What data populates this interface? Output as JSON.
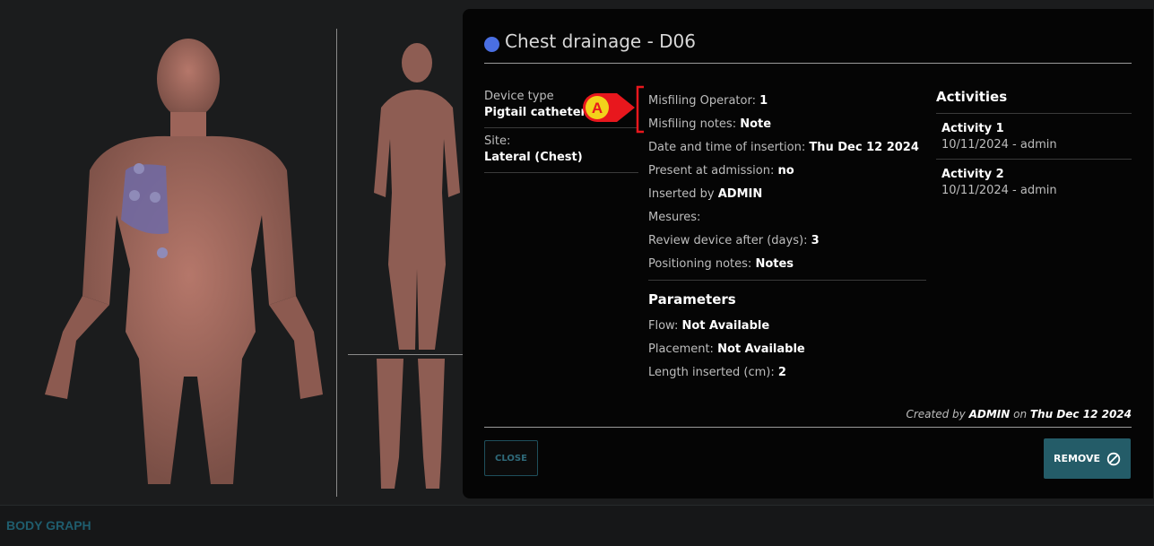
{
  "footer": {
    "label": "BODY GRAPH"
  },
  "modal": {
    "title": "Chest drainage - D06",
    "status_color": "#4a6fe3",
    "left_fields": [
      {
        "label": "Device type",
        "value": "Pigtail catheter"
      },
      {
        "label": "Site:",
        "value": "Lateral (Chest)"
      }
    ],
    "details": [
      {
        "label": "Misfiling Operator: ",
        "value": "1"
      },
      {
        "label": "Misfiling notes: ",
        "value": "Note"
      },
      {
        "label": "Date and time of insertion: ",
        "value": "Thu Dec 12 2024"
      },
      {
        "label": "Present at admission: ",
        "value": "no"
      },
      {
        "label": "Inserted by ",
        "value": "ADMIN"
      },
      {
        "label": "Mesures:",
        "value": ""
      },
      {
        "label": "Review device after (days): ",
        "value": "3"
      },
      {
        "label": "Positioning notes: ",
        "value": "Notes"
      }
    ],
    "parameters_heading": "Parameters",
    "parameters": [
      {
        "label": "Flow: ",
        "value": "Not Available"
      },
      {
        "label": "Placement: ",
        "value": "Not Available"
      },
      {
        "label": "Length inserted (cm): ",
        "value": "2"
      }
    ],
    "activities_heading": "Activities",
    "activities": [
      {
        "title": "Activity 1",
        "meta": "10/11/2024 - admin"
      },
      {
        "title": "Activity 2",
        "meta": "10/11/2024 - admin"
      }
    ],
    "created": {
      "prefix": "Created by ",
      "user": "ADMIN",
      "middle": " on ",
      "date": "Thu Dec 12 2024"
    },
    "close_label": "CLOSE",
    "remove_label": "REMOVE",
    "remove_icon": "ban-icon"
  },
  "annotation": {
    "letter": "A",
    "color": "#e8171d",
    "badge_fill": "#f2d21b"
  }
}
